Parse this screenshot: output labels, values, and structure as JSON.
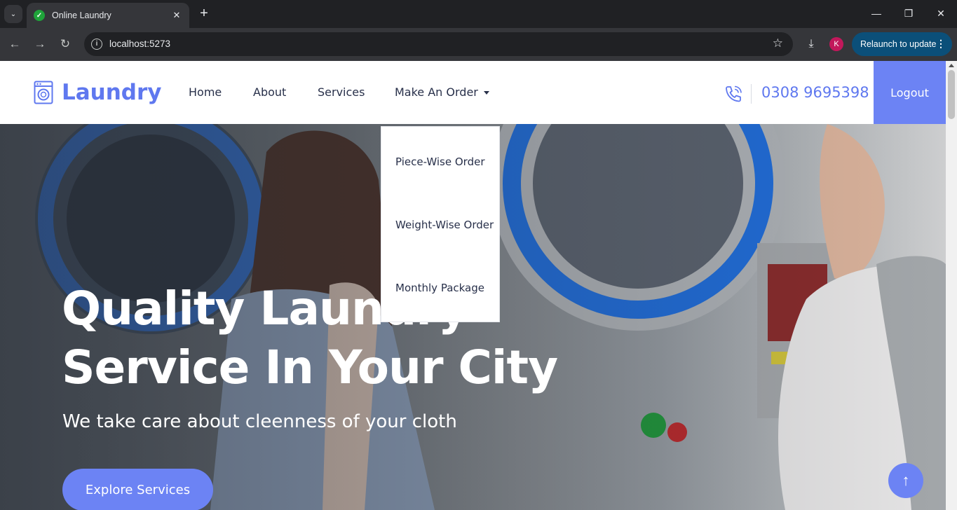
{
  "browser": {
    "tab_title": "Online Laundry",
    "url": "localhost:5273",
    "profile_initial": "K",
    "relaunch_label": "Relaunch to update"
  },
  "header": {
    "logo_text": "Laundry",
    "menu": [
      "Home",
      "About",
      "Services",
      "Make An Order"
    ],
    "phone": "0308 9695398",
    "logout_label": "Logout"
  },
  "dropdown": {
    "items": [
      "Piece-Wise Order",
      "Weight-Wise Order",
      "Monthly Package"
    ]
  },
  "hero": {
    "title_line1": "Quality Laundry",
    "title_line2": "Service In Your City",
    "subtitle": "We take care about cleenness of your cloth",
    "cta_label": "Explore Services"
  },
  "colors": {
    "accent": "#6c83f4",
    "brand_text": "#5f78ef",
    "nav_text": "#28304a"
  },
  "icons": [
    "washing-machine-icon",
    "phone-icon",
    "arrow-up-icon"
  ]
}
